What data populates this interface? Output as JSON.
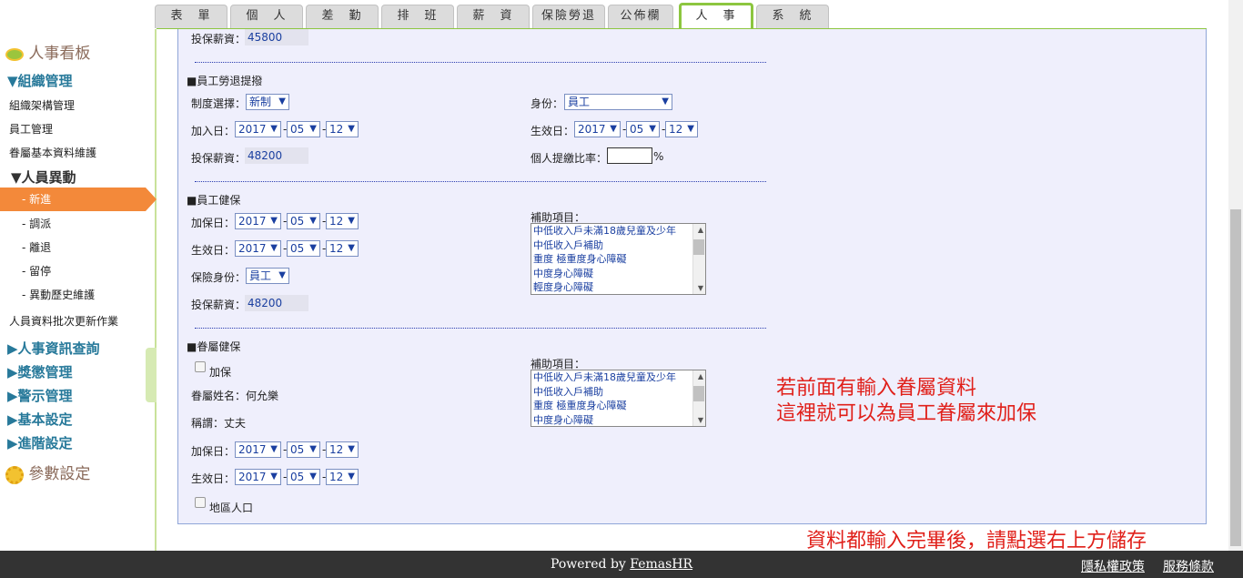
{
  "tabs": [
    "表　單",
    "個　人",
    "差　勤",
    "排　班",
    "薪　資",
    "保險勞退",
    "公佈欄",
    "人　事",
    "系　統"
  ],
  "sidebar": {
    "board": "人事看板",
    "org": "▼組織管理",
    "org_items": [
      "組織架構管理",
      "員工管理",
      "眷屬基本資料維護"
    ],
    "change": "▼人員異動",
    "change_items": [
      "- 新進",
      "- 調派",
      "- 離退",
      "- 留停",
      "- 異動歷史維護"
    ],
    "batch": "人員資料批次更新作業",
    "sections": [
      "▶人事資訊查詢",
      "▶獎懲管理",
      "▶警示管理",
      "▶基本設定",
      "▶進階設定"
    ],
    "params": "參數設定"
  },
  "top_salary": {
    "label": "投保薪資：",
    "value": "45800"
  },
  "pension": {
    "title": "■員工勞退提撥",
    "system_label": "制度選擇：",
    "system_value": "新制",
    "identity_label": "身份：",
    "identity_value": "員工",
    "join_label": "加入日：",
    "join": [
      "2017",
      "05",
      "12"
    ],
    "effective_label": "生效日：",
    "effective": [
      "2017",
      "05",
      "12"
    ],
    "salary_label": "投保薪資：",
    "salary_value": "48200",
    "rate_label": "個人提繳比率：",
    "rate_unit": "%"
  },
  "health": {
    "title": "■員工健保",
    "add_label": "加保日：",
    "add": [
      "2017",
      "05",
      "12"
    ],
    "effective_label": "生效日：",
    "effective": [
      "2017",
      "05",
      "12"
    ],
    "identity_label": "保險身份：",
    "identity_value": "員工",
    "salary_label": "投保薪資：",
    "salary_value": "48200",
    "subsidy_label": "補助項目：",
    "subsidy_options": [
      "中低收入戶未滿18歲兒童及少年",
      "中低收入戶補助",
      "重度 極重度身心障礙",
      "中度身心障礙",
      "輕度身心障礙"
    ]
  },
  "dependent": {
    "title": "■眷屬健保",
    "enroll_label": "加保",
    "name_label": "眷屬姓名：何允樂",
    "title_label": "稱謂：丈夫",
    "add_label": "加保日：",
    "add": [
      "2017",
      "05",
      "12"
    ],
    "effective_label": "生效日：",
    "effective": [
      "2017",
      "05",
      "12"
    ],
    "region_label": "地區人口",
    "subsidy_label": "補助項目：",
    "subsidy_options": [
      "中低收入戶未滿18歲兒童及少年",
      "中低收入戶補助",
      "重度 極重度身心障礙",
      "中度身心障礙"
    ]
  },
  "notes": {
    "line1": "若前面有輸入眷屬資料",
    "line2": "這裡就可以為員工眷屬來加保",
    "save": "資料都輸入完畢後，請點選右上方儲存"
  },
  "footer": {
    "powered": "Powered by ",
    "brand": "FemasHR",
    "privacy": "隱私權政策",
    "terms": "服務條款"
  },
  "colors": {
    "accent": "#8cc63f",
    "active": "#f3893a",
    "note": "#e0201a"
  }
}
